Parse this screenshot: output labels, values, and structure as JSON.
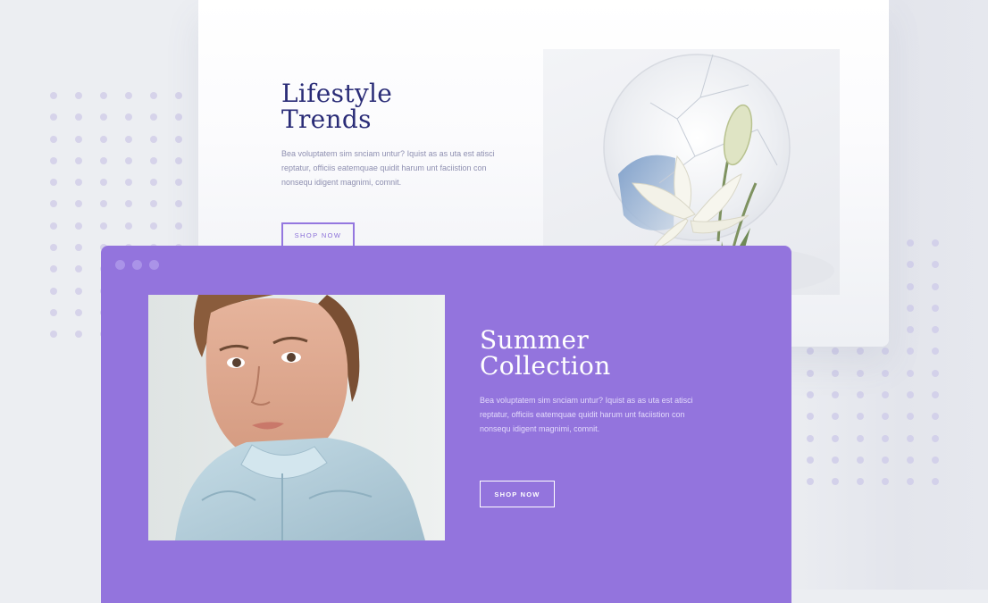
{
  "lifestyle": {
    "title": "Lifestyle\nTrends",
    "body": "Bea voluptatem sim snciam untur? Iquist as as uta est atisci reptatur, officiis eatemquae quidit harum unt faciistion con nonsequ idigent magnimi, comnit.",
    "button_label": "SHOP NOW",
    "image": "lily-in-broken-mirror-photo"
  },
  "summer": {
    "title": "Summer\nCollection",
    "body": "Bea voluptatem sim snciam untur? Iquist as as uta est atisci reptatur, officiis eatemquae quidit harum unt faciistion con nonsequ idigent magnimi, comnit.",
    "button_label": "SHOP NOW",
    "image": "young-woman-portrait-photo"
  },
  "window_controls": [
    "window-dot",
    "window-dot",
    "window-dot"
  ],
  "colors": {
    "accent_purple": "#9374dd",
    "title_navy": "#2a2c77",
    "background": "#eceef2"
  }
}
